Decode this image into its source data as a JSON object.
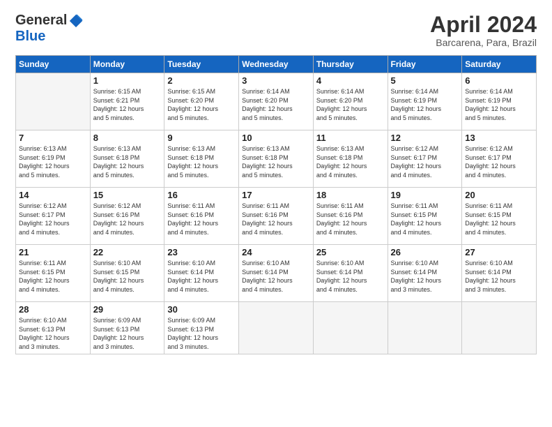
{
  "header": {
    "logo_general": "General",
    "logo_blue": "Blue",
    "month_title": "April 2024",
    "subtitle": "Barcarena, Para, Brazil"
  },
  "days_of_week": [
    "Sunday",
    "Monday",
    "Tuesday",
    "Wednesday",
    "Thursday",
    "Friday",
    "Saturday"
  ],
  "weeks": [
    [
      {
        "day": "",
        "info": ""
      },
      {
        "day": "1",
        "info": "Sunrise: 6:15 AM\nSunset: 6:21 PM\nDaylight: 12 hours\nand 5 minutes."
      },
      {
        "day": "2",
        "info": "Sunrise: 6:15 AM\nSunset: 6:20 PM\nDaylight: 12 hours\nand 5 minutes."
      },
      {
        "day": "3",
        "info": "Sunrise: 6:14 AM\nSunset: 6:20 PM\nDaylight: 12 hours\nand 5 minutes."
      },
      {
        "day": "4",
        "info": "Sunrise: 6:14 AM\nSunset: 6:20 PM\nDaylight: 12 hours\nand 5 minutes."
      },
      {
        "day": "5",
        "info": "Sunrise: 6:14 AM\nSunset: 6:19 PM\nDaylight: 12 hours\nand 5 minutes."
      },
      {
        "day": "6",
        "info": "Sunrise: 6:14 AM\nSunset: 6:19 PM\nDaylight: 12 hours\nand 5 minutes."
      }
    ],
    [
      {
        "day": "7",
        "info": "Sunrise: 6:13 AM\nSunset: 6:19 PM\nDaylight: 12 hours\nand 5 minutes."
      },
      {
        "day": "8",
        "info": "Sunrise: 6:13 AM\nSunset: 6:18 PM\nDaylight: 12 hours\nand 5 minutes."
      },
      {
        "day": "9",
        "info": "Sunrise: 6:13 AM\nSunset: 6:18 PM\nDaylight: 12 hours\nand 5 minutes."
      },
      {
        "day": "10",
        "info": "Sunrise: 6:13 AM\nSunset: 6:18 PM\nDaylight: 12 hours\nand 5 minutes."
      },
      {
        "day": "11",
        "info": "Sunrise: 6:13 AM\nSunset: 6:18 PM\nDaylight: 12 hours\nand 4 minutes."
      },
      {
        "day": "12",
        "info": "Sunrise: 6:12 AM\nSunset: 6:17 PM\nDaylight: 12 hours\nand 4 minutes."
      },
      {
        "day": "13",
        "info": "Sunrise: 6:12 AM\nSunset: 6:17 PM\nDaylight: 12 hours\nand 4 minutes."
      }
    ],
    [
      {
        "day": "14",
        "info": "Sunrise: 6:12 AM\nSunset: 6:17 PM\nDaylight: 12 hours\nand 4 minutes."
      },
      {
        "day": "15",
        "info": "Sunrise: 6:12 AM\nSunset: 6:16 PM\nDaylight: 12 hours\nand 4 minutes."
      },
      {
        "day": "16",
        "info": "Sunrise: 6:11 AM\nSunset: 6:16 PM\nDaylight: 12 hours\nand 4 minutes."
      },
      {
        "day": "17",
        "info": "Sunrise: 6:11 AM\nSunset: 6:16 PM\nDaylight: 12 hours\nand 4 minutes."
      },
      {
        "day": "18",
        "info": "Sunrise: 6:11 AM\nSunset: 6:16 PM\nDaylight: 12 hours\nand 4 minutes."
      },
      {
        "day": "19",
        "info": "Sunrise: 6:11 AM\nSunset: 6:15 PM\nDaylight: 12 hours\nand 4 minutes."
      },
      {
        "day": "20",
        "info": "Sunrise: 6:11 AM\nSunset: 6:15 PM\nDaylight: 12 hours\nand 4 minutes."
      }
    ],
    [
      {
        "day": "21",
        "info": "Sunrise: 6:11 AM\nSunset: 6:15 PM\nDaylight: 12 hours\nand 4 minutes."
      },
      {
        "day": "22",
        "info": "Sunrise: 6:10 AM\nSunset: 6:15 PM\nDaylight: 12 hours\nand 4 minutes."
      },
      {
        "day": "23",
        "info": "Sunrise: 6:10 AM\nSunset: 6:14 PM\nDaylight: 12 hours\nand 4 minutes."
      },
      {
        "day": "24",
        "info": "Sunrise: 6:10 AM\nSunset: 6:14 PM\nDaylight: 12 hours\nand 4 minutes."
      },
      {
        "day": "25",
        "info": "Sunrise: 6:10 AM\nSunset: 6:14 PM\nDaylight: 12 hours\nand 4 minutes."
      },
      {
        "day": "26",
        "info": "Sunrise: 6:10 AM\nSunset: 6:14 PM\nDaylight: 12 hours\nand 3 minutes."
      },
      {
        "day": "27",
        "info": "Sunrise: 6:10 AM\nSunset: 6:14 PM\nDaylight: 12 hours\nand 3 minutes."
      }
    ],
    [
      {
        "day": "28",
        "info": "Sunrise: 6:10 AM\nSunset: 6:13 PM\nDaylight: 12 hours\nand 3 minutes."
      },
      {
        "day": "29",
        "info": "Sunrise: 6:09 AM\nSunset: 6:13 PM\nDaylight: 12 hours\nand 3 minutes."
      },
      {
        "day": "30",
        "info": "Sunrise: 6:09 AM\nSunset: 6:13 PM\nDaylight: 12 hours\nand 3 minutes."
      },
      {
        "day": "",
        "info": ""
      },
      {
        "day": "",
        "info": ""
      },
      {
        "day": "",
        "info": ""
      },
      {
        "day": "",
        "info": ""
      }
    ]
  ]
}
